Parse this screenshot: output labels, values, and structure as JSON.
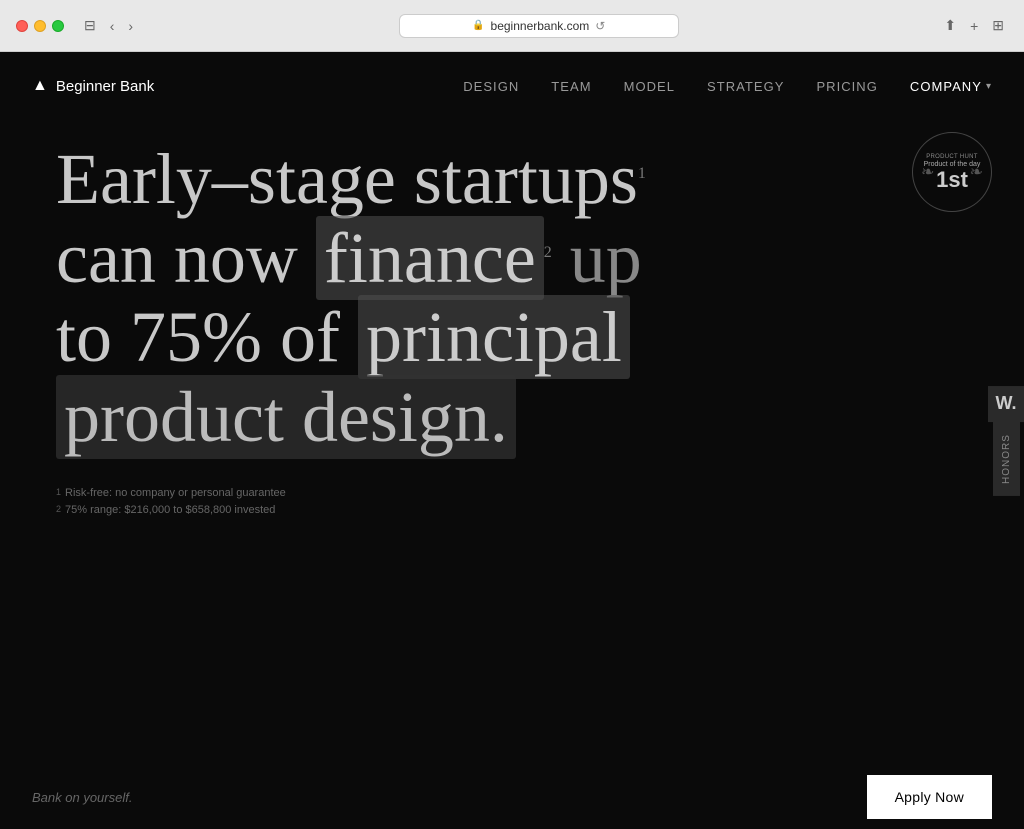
{
  "browser": {
    "url": "beginnerbank.com",
    "traffic_lights": [
      "red",
      "yellow",
      "green"
    ]
  },
  "nav": {
    "logo_text": "Beginner Bank",
    "links": [
      {
        "label": "DESIGN",
        "id": "design"
      },
      {
        "label": "TEAM",
        "id": "team"
      },
      {
        "label": "MODEL",
        "id": "model"
      },
      {
        "label": "STRATEGY",
        "id": "strategy"
      },
      {
        "label": "PRICING",
        "id": "pricing"
      },
      {
        "label": "COMPANY",
        "id": "company"
      }
    ]
  },
  "product_hunt": {
    "label": "PRODUCT HUNT",
    "subtitle": "Product of the day",
    "rank": "1st"
  },
  "hero": {
    "line1": "Early–stage startups",
    "line1_sup": "1",
    "line2_part1": "can now",
    "line2_highlight": "finance",
    "line2_sup": "2",
    "line2_end": "up",
    "line3": "to 75% of",
    "line3_highlight": "principal",
    "line4_highlight": "product design."
  },
  "footnotes": [
    {
      "num": "1",
      "text": "Risk-free: no company or personal guarantee"
    },
    {
      "num": "2",
      "text": "75% range: $216,000 to $658,800 invested"
    }
  ],
  "bottom": {
    "tagline": "Bank on yourself.",
    "apply_label": "Apply Now"
  },
  "side_tab": {
    "w_label": "W.",
    "honors_label": "Honors"
  }
}
